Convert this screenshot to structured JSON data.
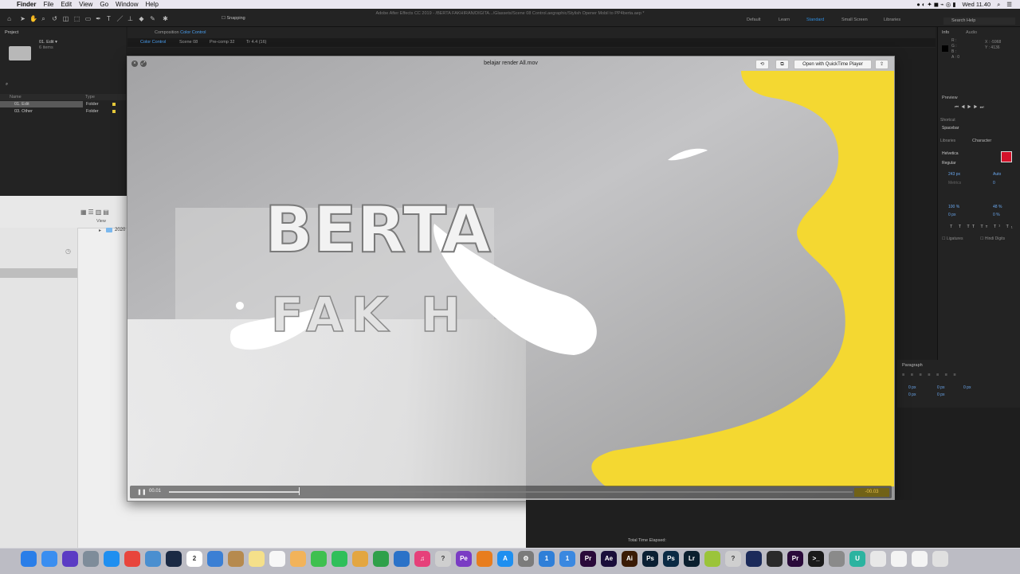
{
  "menubar": {
    "apple": "",
    "items": [
      "Finder",
      "File",
      "Edit",
      "View",
      "Go",
      "Window",
      "Help"
    ],
    "clock": "Wed 11.40"
  },
  "ae": {
    "window_title": "Adobe After Effects CC 2019 - /BERTA FAKHIRAN/DIGITA.../Glassets/Scene 08 Control.aegraphic/Stylish Opener Mobil to PP4berta.aep *",
    "snapping_label": "Snapping",
    "workspaces": [
      "Default",
      "Learn",
      "Standard",
      "Small Screen",
      "Libraries"
    ],
    "search_help": "Search Help"
  },
  "project": {
    "tab": "Project",
    "selected_name": "01. Edit ▾",
    "selected_count": "6 items",
    "col_name": "Name",
    "col_type": "Type",
    "rows": [
      {
        "name": "01. Edit",
        "type": "Folder"
      },
      {
        "name": "03. Other",
        "type": "Folder"
      }
    ]
  },
  "comp": {
    "header": "Composition",
    "name": "Color Control",
    "tabs": [
      "Color Control",
      "Scene 08",
      "Pre-comp 32",
      "Tr 4.4 (16)"
    ]
  },
  "quicktime": {
    "title": "belajar render All.mov",
    "open_button": "Open with QuickTime Player",
    "time_elapsed": "00.01",
    "time_remaining": "-00.03",
    "progress": 0.19,
    "video_text_line1": "BERTA",
    "video_text_line2": "FAK H"
  },
  "right_panels": {
    "info_tab": "Info",
    "audio_tab": "Audio",
    "preview_tab": "Preview",
    "shortcut_label": "Shortcut",
    "shortcut_value": "Spacebar",
    "libraries_tab": "Libraries",
    "character_tab": "Character",
    "font_name": "Helvetica",
    "font_style": "Regular",
    "font_size": "243 px",
    "leading": "Auto",
    "tracking": "0",
    "kerning": "Metrics",
    "vert_scale": "100 %",
    "horiz_scale": "48 %",
    "baseline": "0 px",
    "tsume": "0 %",
    "ligatures": "Ligatures",
    "hindi_digits": "Hindi Digits",
    "paragraph_tab": "Paragraph",
    "para_values": [
      "0 px",
      "0 px",
      "0 px",
      "0 px",
      "0 px"
    ],
    "info_x": "X : -5968",
    "info_y": "Y : 4136",
    "info_rgba": [
      "R :",
      "G :",
      "B :",
      "A : 0"
    ],
    "text_color": "#d3122a"
  },
  "finder": {
    "view_label": "View",
    "folder_name": "2020"
  },
  "timeline": {
    "total_time": "Total Time Elapsed:"
  },
  "dock": {
    "icons": [
      {
        "name": "finder",
        "color": "#2a7ee8",
        "glyph": ""
      },
      {
        "name": "files",
        "color": "#3a8ef0",
        "glyph": ""
      },
      {
        "name": "siri",
        "color": "#5b3cc4",
        "glyph": ""
      },
      {
        "name": "launchpad",
        "color": "#7e8c9a",
        "glyph": ""
      },
      {
        "name": "safari",
        "color": "#1f8ff0",
        "glyph": ""
      },
      {
        "name": "chrome",
        "color": "#e8453c",
        "glyph": ""
      },
      {
        "name": "preview",
        "color": "#4a8fd0",
        "glyph": ""
      },
      {
        "name": "quicktime",
        "color": "#1b2a44",
        "glyph": ""
      },
      {
        "name": "calendar",
        "color": "#ffffff",
        "glyph": "2"
      },
      {
        "name": "keynote",
        "color": "#3b7fd4",
        "glyph": ""
      },
      {
        "name": "notebook",
        "color": "#b68a4e",
        "glyph": ""
      },
      {
        "name": "notes",
        "color": "#f5e08a",
        "glyph": ""
      },
      {
        "name": "reminders",
        "color": "#f7f7f7",
        "glyph": ""
      },
      {
        "name": "photos",
        "color": "#f2b35a",
        "glyph": ""
      },
      {
        "name": "messages",
        "color": "#3fc04f",
        "glyph": ""
      },
      {
        "name": "facetime",
        "color": "#2fbf5a",
        "glyph": ""
      },
      {
        "name": "scripteditor",
        "color": "#e3a640",
        "glyph": ""
      },
      {
        "name": "numbers",
        "color": "#2fa04a",
        "glyph": ""
      },
      {
        "name": "keynote2",
        "color": "#2b72c8",
        "glyph": ""
      },
      {
        "name": "itunes",
        "color": "#e6407a",
        "glyph": "♫"
      },
      {
        "name": "unknown",
        "color": "#cfcfcf",
        "glyph": "?"
      },
      {
        "name": "pe",
        "color": "#7a3cc4",
        "glyph": "Pe"
      },
      {
        "name": "blender",
        "color": "#e87d1e",
        "glyph": ""
      },
      {
        "name": "appstore",
        "color": "#1e8ff0",
        "glyph": "A"
      },
      {
        "name": "settings",
        "color": "#7b7b7b",
        "glyph": "⚙"
      },
      {
        "name": "one",
        "color": "#2f7fd8",
        "glyph": "1"
      },
      {
        "name": "one2",
        "color": "#3a88e0",
        "glyph": "1"
      },
      {
        "name": "premiere",
        "color": "#2a0a3a",
        "glyph": "Pr"
      },
      {
        "name": "aftereffects",
        "color": "#1a0e3a",
        "glyph": "Ae"
      },
      {
        "name": "illustrator",
        "color": "#3a1b05",
        "glyph": "Ai"
      },
      {
        "name": "photoshop",
        "color": "#0a1f33",
        "glyph": "Ps"
      },
      {
        "name": "photoshop2",
        "color": "#0a2a44",
        "glyph": "Ps"
      },
      {
        "name": "lightroom",
        "color": "#0a1f2e",
        "glyph": "Lr"
      },
      {
        "name": "android",
        "color": "#9bc43a",
        "glyph": ""
      },
      {
        "name": "unknown2",
        "color": "#cfcfcf",
        "glyph": "?"
      },
      {
        "name": "cinema4d",
        "color": "#1b2a5a",
        "glyph": ""
      },
      {
        "name": "davinci",
        "color": "#2a2a2a",
        "glyph": ""
      },
      {
        "name": "premiere2",
        "color": "#2a0a3a",
        "glyph": "Pr"
      },
      {
        "name": "terminal",
        "color": "#1a1a1a",
        "glyph": ">_"
      },
      {
        "name": "unknown3",
        "color": "#8a8a8a",
        "glyph": ""
      },
      {
        "name": "upwork",
        "color": "#2bb3a0",
        "glyph": "U"
      },
      {
        "name": "printer",
        "color": "#e8e8e8",
        "glyph": ""
      },
      {
        "name": "doc",
        "color": "#f4f4f4",
        "glyph": ""
      },
      {
        "name": "window",
        "color": "#f4f4f4",
        "glyph": ""
      },
      {
        "name": "trash",
        "color": "#e0e0e0",
        "glyph": ""
      }
    ]
  }
}
